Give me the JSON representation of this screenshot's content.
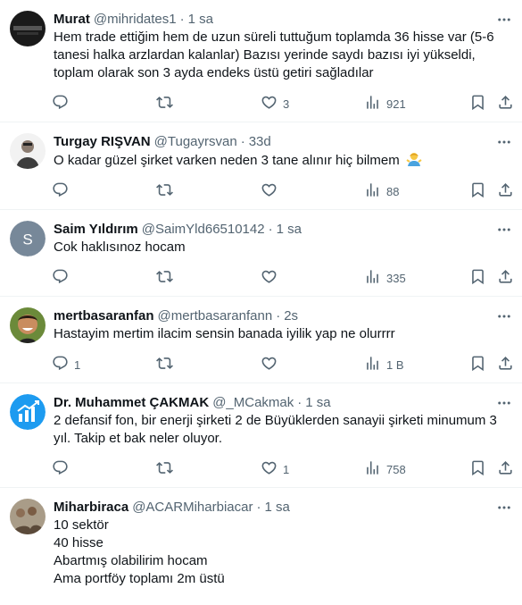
{
  "tweets": [
    {
      "name": "Murat",
      "handle": "@mihridates1",
      "time": "1 sa",
      "text": [
        "Hem trade ettiğim hem de uzun süreli tuttuğum toplamda 36 hisse var (5-6",
        "tanesi halka arzlardan kalanlar) Bazısı yerinde saydı bazısı iyi yükseldi,",
        "toplam olarak son 3 ayda endeks üstü getiri sağladılar"
      ],
      "avatar": {
        "type": "image",
        "desc": "dark-photo"
      },
      "replies": "",
      "retweets": "",
      "likes": "3",
      "views": "921"
    },
    {
      "name": "Turgay RIŞVAN",
      "handle": "@Tugayrsvan",
      "time": "33d",
      "text": [
        "O kadar güzel şirket varken neden 3 tane alınır hiç bilmem"
      ],
      "emoji": "shrug-emoji",
      "avatar": {
        "type": "image",
        "desc": "man-portrait"
      },
      "replies": "",
      "retweets": "",
      "likes": "",
      "views": "88"
    },
    {
      "name": "Saim Yıldırım",
      "handle": "@SaimYld66510142",
      "time": "1 sa",
      "text": [
        "Cok haklısınoz hocam"
      ],
      "avatar": {
        "type": "letter",
        "letter": "S",
        "color": "#778899"
      },
      "replies": "",
      "retweets": "",
      "likes": "",
      "views": "335"
    },
    {
      "name": "mertbasaranfan",
      "handle": "@mertbasaranfann",
      "time": "2s",
      "text": [
        "Hastayim mertim ilacim sensin banada iyilik yap ne olurrrr"
      ],
      "avatar": {
        "type": "image",
        "desc": "smiling-man"
      },
      "replies": "1",
      "retweets": "",
      "likes": "",
      "views": "1 B"
    },
    {
      "name": "Dr. Muhammet ÇAKMAK",
      "handle": "@_MCakmak",
      "time": "1 sa",
      "text": [
        "2 defansif fon, bir enerji şirketi 2 de Büyüklerden sanayii şirketi minumum 3",
        "yıl. Takip et bak neler oluyor."
      ],
      "avatar": {
        "type": "chart-logo",
        "color": "#1d9bf0"
      },
      "replies": "",
      "retweets": "",
      "likes": "1",
      "views": "758"
    },
    {
      "name": "Miharbiraca",
      "handle": "@ACARMiharbiacar",
      "time": "1 sa",
      "text": [
        "10 sektör",
        "40 hisse",
        "Abartmış olabilirim hocam",
        "Ama portföy toplamı 2m üstü"
      ],
      "avatar": {
        "type": "image",
        "desc": "group-photo"
      },
      "partial": true
    }
  ],
  "colors": {
    "text": "#0f1419",
    "secondary": "#536471",
    "border": "#eff3f4",
    "accent": "#1d9bf0"
  }
}
